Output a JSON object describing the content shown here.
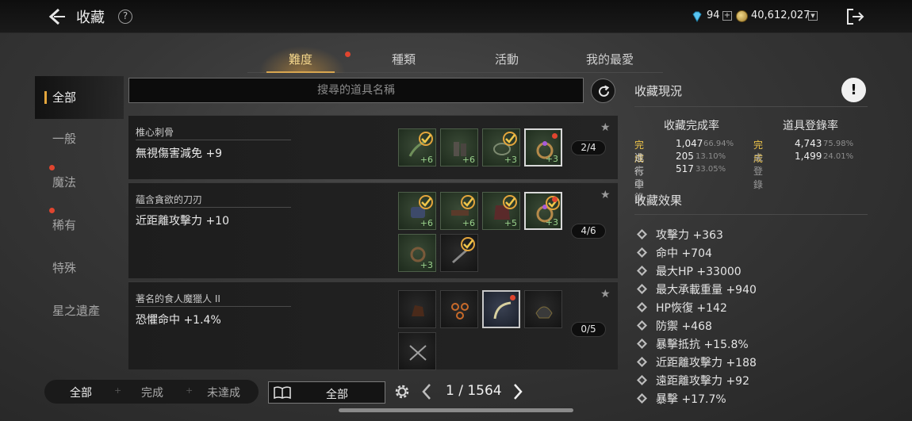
{
  "header": {
    "title": "收藏",
    "help": "?",
    "diamonds": "94",
    "gold": "40,612,027"
  },
  "tabs": [
    {
      "label": "難度",
      "active": true,
      "dot": true
    },
    {
      "label": "種類",
      "active": false,
      "dot": false
    },
    {
      "label": "活動",
      "active": false,
      "dot": false
    },
    {
      "label": "我的最愛",
      "active": false,
      "dot": false
    }
  ],
  "categories": [
    {
      "label": "全部",
      "active": true,
      "dot": false
    },
    {
      "label": "一般",
      "active": false,
      "dot": false
    },
    {
      "label": "魔法",
      "active": false,
      "dot": true
    },
    {
      "label": "稀有",
      "active": false,
      "dot": true
    },
    {
      "label": "特殊",
      "active": false,
      "dot": false
    },
    {
      "label": "星之遺產",
      "active": false,
      "dot": false
    }
  ],
  "search": {
    "placeholder": "搜尋的道具名稱"
  },
  "collections": [
    {
      "name": "椎心刺骨",
      "effect": "無視傷害減免 +9",
      "count": "2/4",
      "slots": [
        {
          "plus": "+6",
          "check": true,
          "dot": false
        },
        {
          "plus": "+6",
          "check": false,
          "dot": false
        },
        {
          "plus": "+3",
          "check": true,
          "dot": false
        },
        {
          "plus": "+3",
          "check": false,
          "dot": true
        }
      ]
    },
    {
      "name": "蘊含貪欲的刀刃",
      "effect": "近距離攻擊力 +10",
      "count": "4/6",
      "slots": [
        {
          "plus": "+6",
          "check": true,
          "dot": false
        },
        {
          "plus": "+6",
          "check": true,
          "dot": false
        },
        {
          "plus": "+5",
          "check": true,
          "dot": false
        },
        {
          "plus": "+3",
          "check": true,
          "dot": true
        },
        {
          "plus": "+3",
          "check": false,
          "dot": false
        },
        {
          "plus": "",
          "check": true,
          "dot": false
        }
      ]
    },
    {
      "name": "著名的食人魔獵人 II",
      "effect": "恐懼命中 +1.4%",
      "count": "0/5",
      "slots": [
        {
          "plus": "",
          "check": false,
          "dot": false
        },
        {
          "plus": "",
          "check": false,
          "dot": false
        },
        {
          "plus": "",
          "check": false,
          "dot": true
        },
        {
          "plus": "",
          "check": false,
          "dot": false
        },
        {
          "plus": "",
          "check": false,
          "dot": false
        }
      ]
    }
  ],
  "status": {
    "title": "收藏現況",
    "info": "!",
    "completion_title": "收藏完成率",
    "registration_title": "道具登錄率",
    "completion": [
      {
        "label": "完成",
        "value": "1,047",
        "pct": "66.94%",
        "highlight": true
      },
      {
        "label": "進行中",
        "value": "205",
        "pct": "13.10%",
        "highlight": false
      },
      {
        "label": "未登錄",
        "value": "517",
        "pct": "33.05%",
        "highlight": false
      }
    ],
    "registration": [
      {
        "label": "完成",
        "value": "4,743",
        "pct": "75.98%",
        "highlight": true
      },
      {
        "label": "未登錄",
        "value": "1,499",
        "pct": "24.01%",
        "highlight": false
      }
    ]
  },
  "effects": {
    "title": "收藏效果",
    "items": [
      "攻擊力 +363",
      "命中 +704",
      "最大HP +33000",
      "最大承載重量 +940",
      "HP恢復 +142",
      "防禦 +468",
      "暴擊抵抗 +15.8%",
      "近距離攻擊力 +188",
      "遠距離攻擊力 +92",
      "暴擊 +17.7%"
    ]
  },
  "footer": {
    "filters": [
      "全部",
      "完成",
      "未達成"
    ],
    "book_label": "全部",
    "page": "1 / 1564"
  },
  "colors": {
    "accent_gold": "#e3a53c",
    "complete_yellow": "#f0c64a",
    "badge_red": "#e0452f"
  }
}
